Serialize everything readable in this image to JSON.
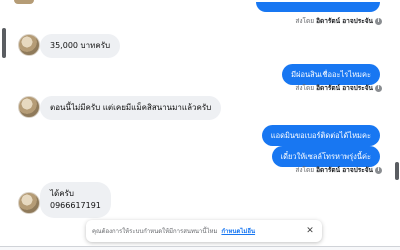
{
  "messages": [
    {
      "text": "35,000 บาทครับ"
    },
    {
      "text": "มีผ่อนสินเชื่ออะไรไหมคะ"
    },
    {
      "text": "ตอนนี้ไม่มีครับ แต่เคยมีแม็คสิสนานมาแล้วครับ"
    },
    {
      "text": "แอดมินขอเบอร์ติดต่อได้ไหมคะ"
    },
    {
      "text": "เดี๋ยวให้เซลล์โทรหาพรุ่งนี้ค่ะ"
    },
    {
      "line1": "ได้ครับ",
      "line2": "0966617191"
    }
  ],
  "sent_by": {
    "prefix": "ส่งโดย",
    "name": "อิดารัตน์ อาจประจัน"
  },
  "notice": {
    "text": "คุณต้องการให้ระบบกำหนดให้มีการสนทนานี้ไหม",
    "link": "กำหนดไม่อีน",
    "close": "✕"
  },
  "colors": {
    "outgoing_bubble": "#1877f2",
    "incoming_bubble": "#eef0f3"
  }
}
